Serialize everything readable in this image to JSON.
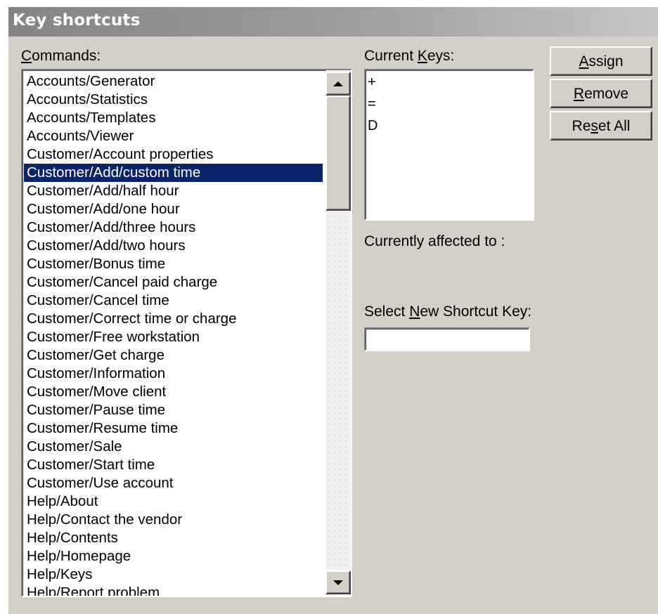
{
  "window": {
    "title": "Key shortcuts"
  },
  "commands": {
    "label_pre": "",
    "label_ul": "C",
    "label_post": "ommands:",
    "selected_index": 5,
    "items": [
      "Accounts/Generator",
      "Accounts/Statistics",
      "Accounts/Templates",
      "Accounts/Viewer",
      "Customer/Account properties",
      "Customer/Add/custom time",
      "Customer/Add/half hour",
      "Customer/Add/one hour",
      "Customer/Add/three hours",
      "Customer/Add/two hours",
      "Customer/Bonus time",
      "Customer/Cancel paid charge",
      "Customer/Cancel time",
      "Customer/Correct time or charge",
      "Customer/Free workstation",
      "Customer/Get charge",
      "Customer/Information",
      "Customer/Move client",
      "Customer/Pause time",
      "Customer/Resume time",
      "Customer/Sale",
      "Customer/Start time",
      "Customer/Use account",
      "Help/About",
      "Help/Contact the vendor",
      "Help/Contents",
      "Help/Homepage",
      "Help/Keys",
      "Help/Report problem"
    ]
  },
  "current_keys": {
    "label_pre": "Current ",
    "label_ul": "K",
    "label_post": "eys:",
    "items": [
      "+",
      "=",
      "D"
    ]
  },
  "affected": {
    "label": "Currently affected to :"
  },
  "new_shortcut": {
    "label_pre": "Select ",
    "label_ul": "N",
    "label_post": "ew Shortcut Key:",
    "value": ""
  },
  "buttons": {
    "assign": {
      "pre": "",
      "ul": "A",
      "post": "ssign"
    },
    "remove": {
      "pre": "",
      "ul": "R",
      "post": "emove"
    },
    "reset": {
      "pre": "Re",
      "ul": "s",
      "post": "et All"
    }
  }
}
